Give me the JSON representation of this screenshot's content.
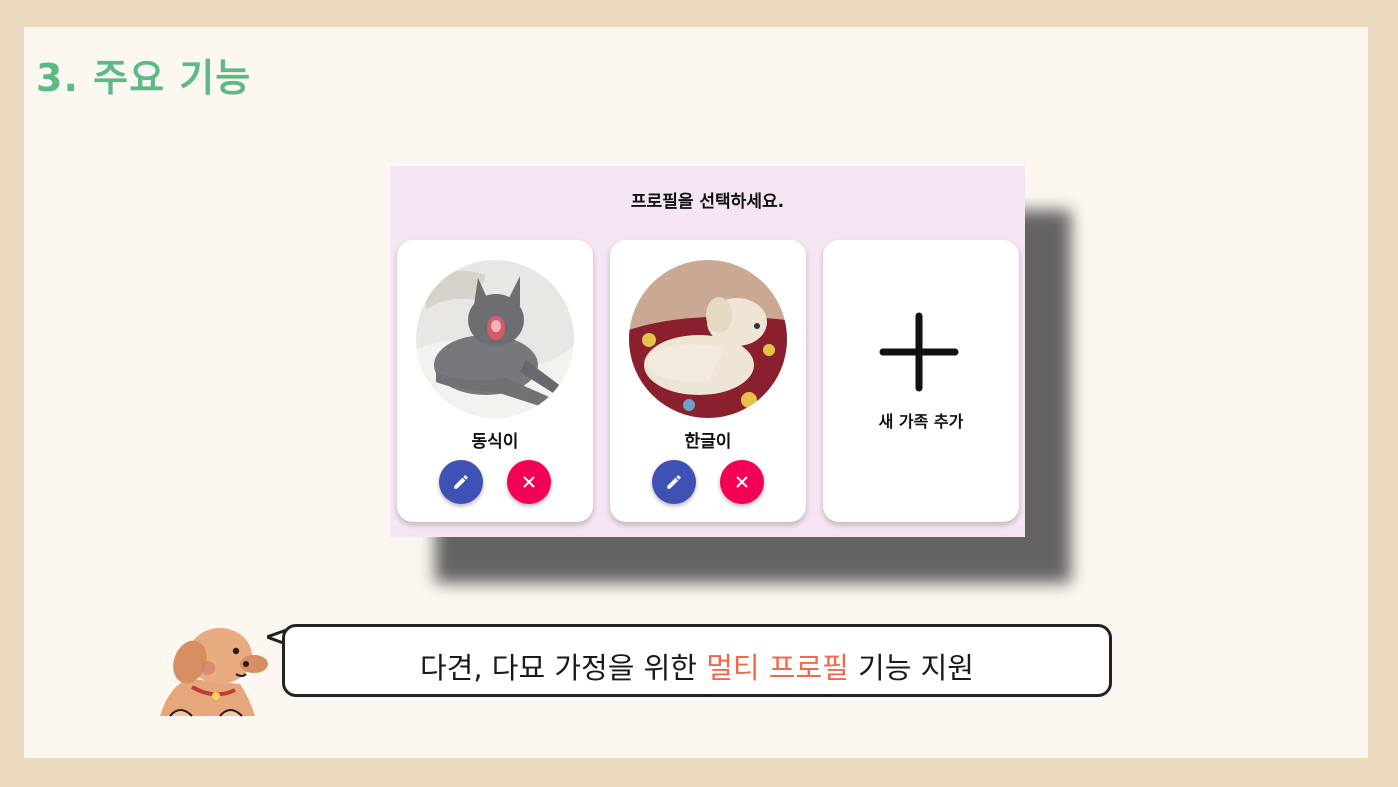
{
  "slide": {
    "title": "3. 주요 기능"
  },
  "app": {
    "prompt": "프로필을 선택하세요.",
    "profiles": [
      {
        "name": "동식이",
        "photo": "gray-cat-photo"
      },
      {
        "name": "한글이",
        "photo": "white-dog-photo"
      }
    ],
    "add_label": "새 가족 추가",
    "icons": {
      "edit": "pencil-icon",
      "delete": "close-icon",
      "add": "plus-icon"
    },
    "colors": {
      "edit": "#3f51b5",
      "delete": "#f50057",
      "background": "#f6e5f3"
    }
  },
  "bubble": {
    "text_before": "다견, 다묘 가정을 위한 ",
    "text_highlight": "멀티 프로필",
    "text_after": " 기능 지원",
    "highlight_color": "#ef6a4a"
  },
  "colors": {
    "title": "#5dba86",
    "frame": "#ecdabf",
    "slide": "#fcf7f1"
  }
}
